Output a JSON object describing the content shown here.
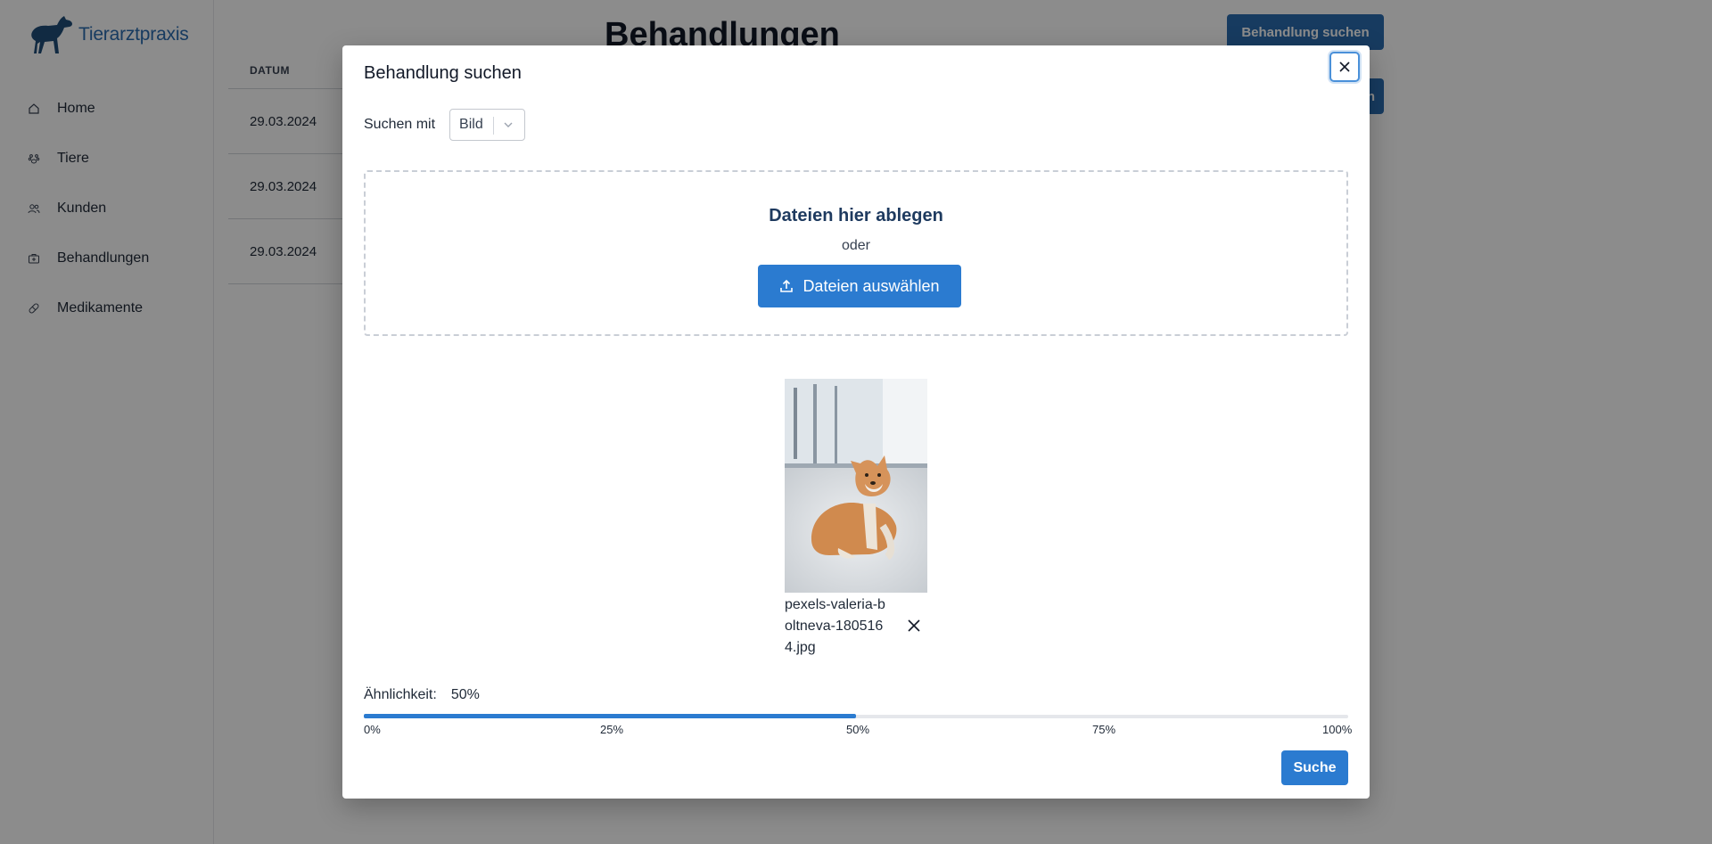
{
  "app": {
    "brand": "Tierarztpraxis",
    "page_title": "Behandlungen",
    "header_button": "Behandlung suchen",
    "second_button": "n",
    "accent_color": "#2b6cb0"
  },
  "sidebar": {
    "items": [
      {
        "label": "Home",
        "icon": "home-icon"
      },
      {
        "label": "Tiere",
        "icon": "paw-icon"
      },
      {
        "label": "Kunden",
        "icon": "users-icon"
      },
      {
        "label": "Behandlungen",
        "icon": "medical-case-icon"
      },
      {
        "label": "Medikamente",
        "icon": "pill-icon"
      }
    ]
  },
  "table": {
    "header": "DATUM",
    "rows": [
      "29.03.2024",
      "29.03.2024",
      "29.03.2024"
    ]
  },
  "modal": {
    "title": "Behandlung suchen",
    "search_with_label": "Suchen mit",
    "search_with_value": "Bild",
    "dropzone": {
      "title": "Dateien hier ablegen",
      "or": "oder",
      "button": "Dateien auswählen"
    },
    "file": {
      "name": "pexels-valeria-boltneva-1805164.jpg"
    },
    "similarity": {
      "label": "Ähnlichkeit:",
      "value_text": "50%",
      "value": 50,
      "ticks": [
        "0%",
        "25%",
        "50%",
        "75%",
        "100%"
      ]
    },
    "submit": "Suche"
  }
}
